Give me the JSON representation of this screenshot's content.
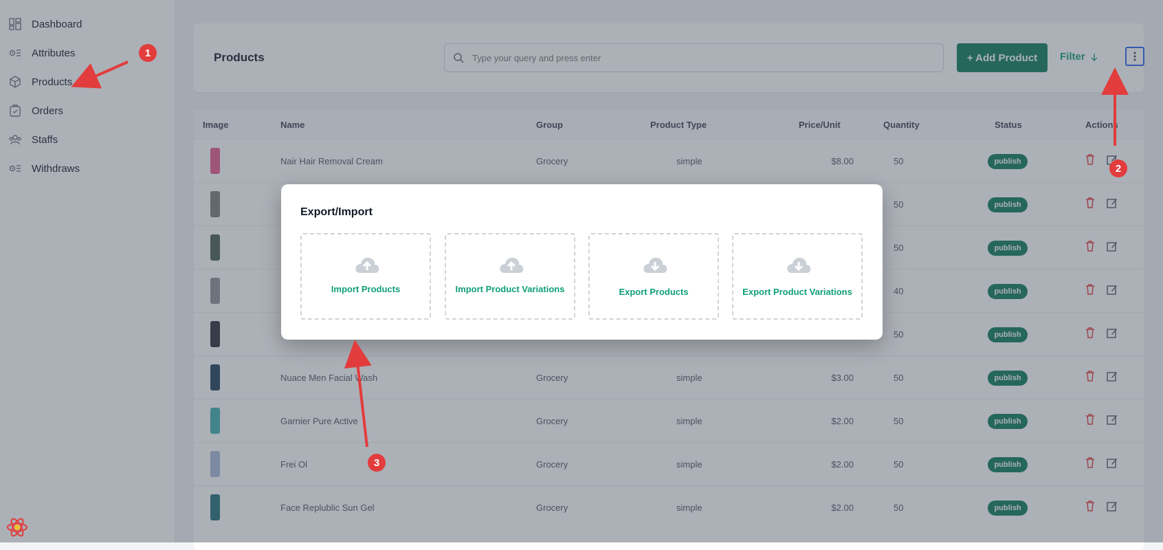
{
  "sidebar": {
    "items": [
      {
        "label": "Dashboard",
        "icon": "dashboard-icon"
      },
      {
        "label": "Attributes",
        "icon": "attributes-icon"
      },
      {
        "label": "Products",
        "icon": "box-icon"
      },
      {
        "label": "Orders",
        "icon": "orders-icon"
      },
      {
        "label": "Staffs",
        "icon": "users-icon"
      },
      {
        "label": "Withdraws",
        "icon": "withdraws-icon"
      }
    ]
  },
  "header": {
    "title": "Products",
    "search_placeholder": "Type your query and press enter",
    "add_label": "+ Add Product",
    "filter_label": "Filter"
  },
  "table": {
    "columns": [
      "Image",
      "Name",
      "Group",
      "Product Type",
      "Price/Unit",
      "Quantity",
      "Status",
      "Actions"
    ],
    "rows": [
      {
        "name": "Nair Hair Removal Cream",
        "group": "Grocery",
        "type": "simple",
        "price": "$8.00",
        "qty": "50",
        "status": "publish",
        "color": "#e85a8a"
      },
      {
        "name": "",
        "group": "",
        "type": "",
        "price": "",
        "qty": "50",
        "status": "publish",
        "color": "#7a7a7a"
      },
      {
        "name": "",
        "group": "",
        "type": "",
        "price": "",
        "qty": "50",
        "status": "publish",
        "color": "#4a5e52"
      },
      {
        "name": "",
        "group": "",
        "type": "",
        "price": "",
        "qty": "40",
        "status": "publish",
        "color": "#8d9095"
      },
      {
        "name": "",
        "group": "",
        "type": "",
        "price": "",
        "qty": "50",
        "status": "publish",
        "color": "#2a2f35"
      },
      {
        "name": "Nuace Men Facial Wash",
        "group": "Grocery",
        "type": "simple",
        "price": "$3.00",
        "qty": "50",
        "status": "publish",
        "color": "#1f3f5a"
      },
      {
        "name": "Garnier Pure Active",
        "group": "Grocery",
        "type": "simple",
        "price": "$2.00",
        "qty": "50",
        "status": "publish",
        "color": "#3fb0b0"
      },
      {
        "name": "Frei Ol",
        "group": "Grocery",
        "type": "simple",
        "price": "$2.00",
        "qty": "50",
        "status": "publish",
        "color": "#a6b9d9"
      },
      {
        "name": "Face Replublic Sun Gel",
        "group": "Grocery",
        "type": "simple",
        "price": "$2.00",
        "qty": "50",
        "status": "publish",
        "color": "#1e6f78"
      }
    ]
  },
  "modal": {
    "title": "Export/Import",
    "tiles": [
      {
        "label": "Import Products",
        "icon": "cloud-upload-icon"
      },
      {
        "label": "Import Product Variations",
        "icon": "cloud-upload-icon"
      },
      {
        "label": "Export Products",
        "icon": "cloud-download-icon"
      },
      {
        "label": "Export Product Variations",
        "icon": "cloud-download-icon"
      }
    ]
  },
  "annotations": [
    "1",
    "2",
    "3"
  ],
  "colors": {
    "accent": "#0b7a5a",
    "link": "#0f9f77",
    "annotation": "#e23c3c",
    "danger": "#e23c3c"
  }
}
